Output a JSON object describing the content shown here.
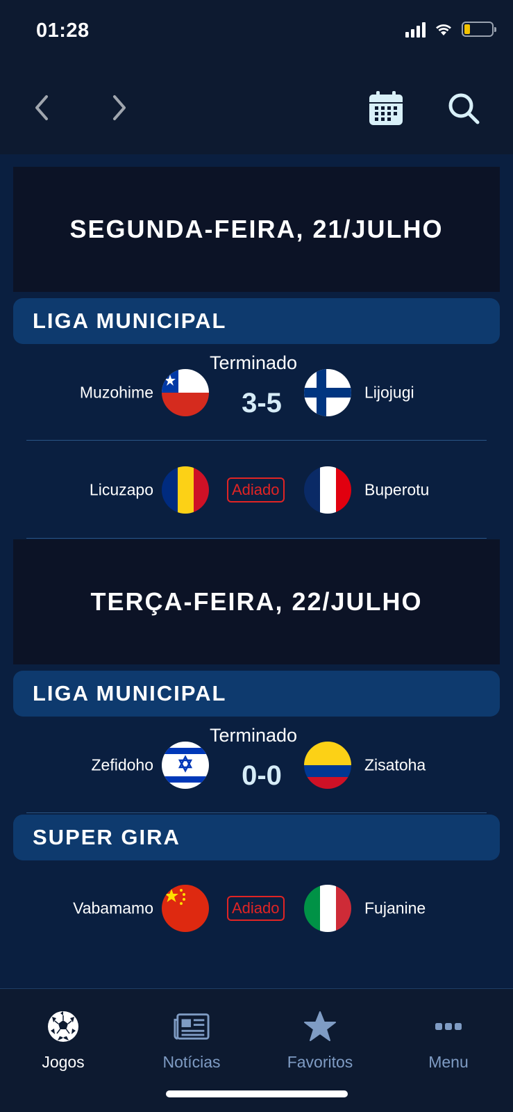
{
  "status_bar": {
    "time": "01:28"
  },
  "toolbar": {
    "prev_icon": "chevron-left-icon",
    "next_icon": "chevron-right-icon",
    "calendar_icon": "calendar-icon",
    "search_icon": "search-icon"
  },
  "days": [
    {
      "title": "SEGUNDA-FEIRA, 21/JULHO",
      "leagues": [
        {
          "name": "LIGA MUNICIPAL",
          "matches": [
            {
              "home": "Muzohime",
              "away": "Lijojugi",
              "status": "Terminado",
              "score": "3-5",
              "home_flag": "chile-flag",
              "away_flag": "finland-flag"
            },
            {
              "home": "Licuzapo",
              "away": "Buperotu",
              "status": "Adiado",
              "home_flag": "romania-flag",
              "away_flag": "france-flag"
            }
          ]
        }
      ]
    },
    {
      "title": "TERÇA-FEIRA, 22/JULHO",
      "leagues": [
        {
          "name": "LIGA MUNICIPAL",
          "matches": [
            {
              "home": "Zefidoho",
              "away": "Zisatoha",
              "status": "Terminado",
              "score": "0-0",
              "home_flag": "israel-flag",
              "away_flag": "colombia-flag"
            }
          ]
        },
        {
          "name": "SUPER GIRA",
          "matches": [
            {
              "home": "Vabamamo",
              "away": "Fujanine",
              "status": "Adiado",
              "home_flag": "china-flag",
              "away_flag": "italy-flag"
            }
          ]
        }
      ]
    }
  ],
  "tabbar": {
    "tabs": [
      {
        "label": "Jogos",
        "icon": "soccer-ball-icon",
        "active": true
      },
      {
        "label": "Notícias",
        "icon": "newspaper-icon",
        "active": false
      },
      {
        "label": "Favoritos",
        "icon": "star-icon",
        "active": false
      },
      {
        "label": "Menu",
        "icon": "more-dots-icon",
        "active": false
      }
    ]
  },
  "colors": {
    "background": "#0a1f40",
    "topbar": "#0d1a30",
    "day_header": "#0c1326",
    "league_bar": "#0e3a6e",
    "postponed": "#e02424",
    "inactive_tab": "#7f9cc4"
  }
}
